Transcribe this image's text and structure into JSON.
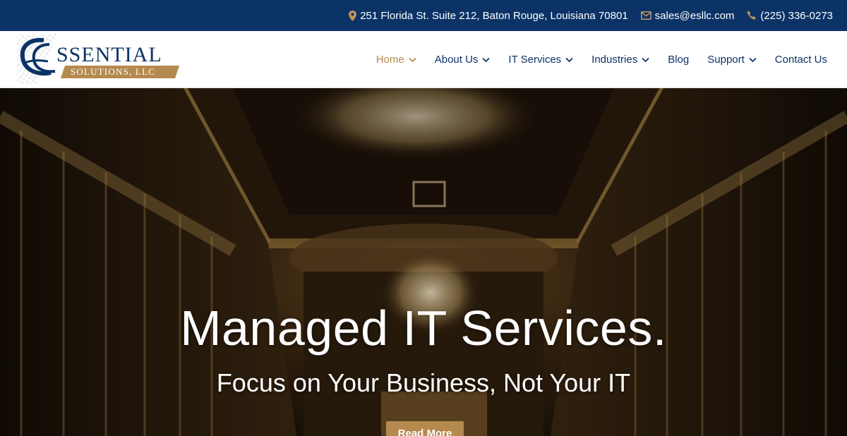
{
  "topbar": {
    "address": "251 Florida St. Suite 212, Baton Rouge, Louisiana 70801",
    "email": "sales@esllc.com",
    "phone": "(225) 336-0273"
  },
  "logo": {
    "line1": "SSENTIAL",
    "line2": "SOLUTIONS, LLC"
  },
  "nav": {
    "items": [
      {
        "label": "Home",
        "dropdown": true,
        "active": true
      },
      {
        "label": "About Us",
        "dropdown": true
      },
      {
        "label": "IT Services",
        "dropdown": true
      },
      {
        "label": "Industries",
        "dropdown": true
      },
      {
        "label": "Blog",
        "dropdown": false
      },
      {
        "label": "Support",
        "dropdown": true
      },
      {
        "label": "Contact Us",
        "dropdown": false
      }
    ]
  },
  "hero": {
    "title": "Managed IT Services.",
    "subtitle": "Focus on Your Business, Not Your IT",
    "cta": "Read More"
  },
  "colors": {
    "navy": "#0b3366",
    "gold": "#b58a4f",
    "icon_gold": "#c4965a"
  }
}
